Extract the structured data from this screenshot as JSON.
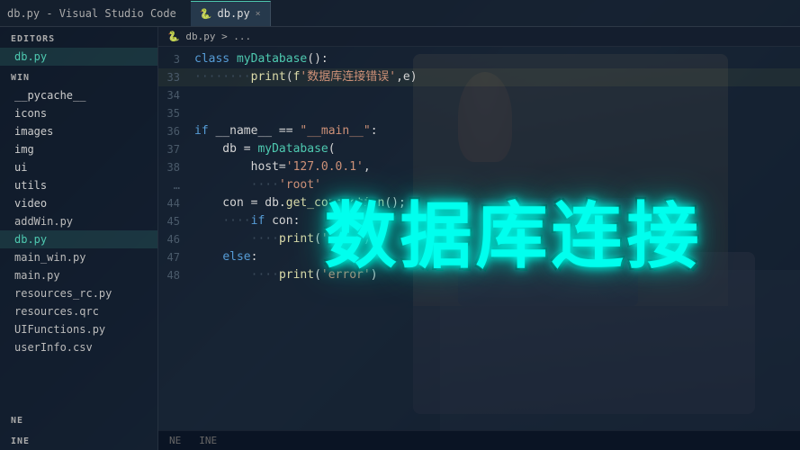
{
  "app": {
    "title": "db.py - Visual Studio Code",
    "tab_label": "db.py",
    "tab_close": "×"
  },
  "breadcrumb": {
    "path": "db.py > ..."
  },
  "sidebar": {
    "editors_label": "EDITORS",
    "editors_items": [
      {
        "name": "db.py",
        "active": true
      }
    ],
    "win_label": "WIN",
    "folders": [
      "__pycache__",
      "icons",
      "images",
      "img",
      "ui",
      "utils",
      "video"
    ],
    "files": [
      "addWin.py",
      "db.py",
      "main_win.py",
      "main.py",
      "resources_rc.py",
      "resources.qrc",
      "UIFunctions.py",
      "userInfo.csv"
    ],
    "bottom_items": [
      "NE",
      "INE"
    ]
  },
  "code": {
    "lines": [
      {
        "num": "3",
        "text": "class myDatabase():",
        "tokens": [
          {
            "type": "kw",
            "t": "class"
          },
          {
            "type": "text",
            "t": " "
          },
          {
            "type": "cls",
            "t": "myDatabase"
          },
          {
            "type": "text",
            "t": "():"
          }
        ]
      },
      {
        "num": "33",
        "text": "        ····print(f'数据库连接错误',e)",
        "indent": 8,
        "dots": 8
      },
      {
        "num": "34",
        "text": ""
      },
      {
        "num": "35",
        "text": ""
      },
      {
        "num": "36",
        "text": "if __name__ == \"__main__\":",
        "has_kw": true
      },
      {
        "num": "37",
        "text": "    db = myDatabase(",
        "indent": 4
      },
      {
        "num": "38",
        "text": "        host='127.0.0.1',",
        "indent": 8
      },
      {
        "num": "...",
        "text": "        ····'root'"
      },
      {
        "num": "44",
        "text": "    con = db.get_connection();"
      },
      {
        "num": "45",
        "text": "    ····if con:"
      },
      {
        "num": "46",
        "text": "        ····print('succ')"
      },
      {
        "num": "47",
        "text": "    else:"
      },
      {
        "num": "48",
        "text": "        ····print('error')"
      }
    ]
  },
  "overlay": {
    "text": "数据库连接"
  },
  "status_bar": {
    "left": "NE",
    "right": "INE"
  }
}
